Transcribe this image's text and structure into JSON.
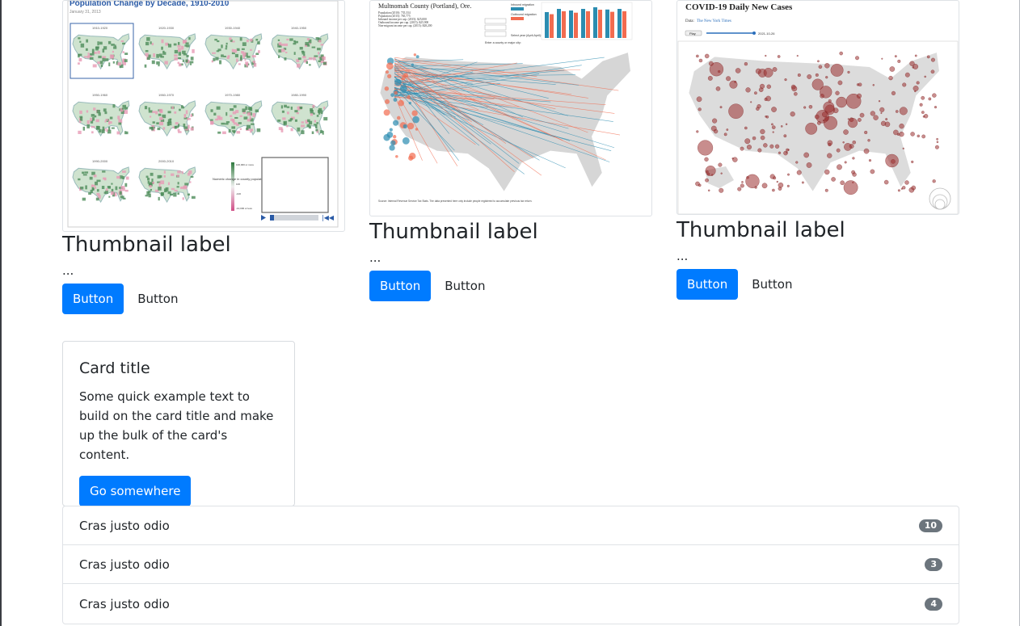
{
  "thumbnails": [
    {
      "image_title": "Population Change by Decade, 1910-2010",
      "image_date": "January 31, 2013",
      "decades": [
        "1910-1920",
        "1920-1930",
        "1930-1940",
        "1940-1950",
        "1950-1960",
        "1960-1970",
        "1970-1980",
        "1980-1990",
        "1990-2000",
        "2000-2010",
        "1910-1920"
      ],
      "legend_title": "Numeric change in county population",
      "legend_ticks": [
        "100,000 or more",
        "100",
        "-100",
        "-10,000 or less"
      ],
      "label": "Thumbnail label",
      "text": "...",
      "primary_button": "Button",
      "secondary_button": "Button"
    },
    {
      "image_title": "Multnomah County (Portland), Ore.",
      "stats": [
        "Population (2010): 735,334",
        "Population (2015): 765,775",
        "Inbound income per cap. (2015): $25,000",
        "Outbound income per cap. (2015): $25,900",
        "Non-migrant income per cap. (2015): $28,200"
      ],
      "legend_inbound": "Inbound migration",
      "legend_outbound": "Outbound migration",
      "select_year": "Select year (April-April):",
      "enter_county": "Enter a county or major city:",
      "footer_note": "Source: Internal Revenue Service Tax Stats. The data presented here only include people registered to accumulate previous tax return.",
      "label": "Thumbnail label",
      "text": "...",
      "primary_button": "Button",
      "secondary_button": "Button"
    },
    {
      "image_title": "COVID-19 Daily New Cases",
      "data_source_prefix": "Data:",
      "data_source": "The New York Times",
      "play_label": "Play",
      "date_readout": "2021-10-26",
      "label": "Thumbnail label",
      "text": "...",
      "primary_button": "Button",
      "secondary_button": "Button"
    }
  ],
  "card": {
    "title": "Card title",
    "text": "Some quick example text to build on the card title and make up the bulk of the card's content.",
    "button": "Go somewhere"
  },
  "list": [
    {
      "text": "Cras justo odio",
      "badge": "10"
    },
    {
      "text": "Cras justo odio",
      "badge": "3"
    },
    {
      "text": "Cras justo odio",
      "badge": "4"
    }
  ],
  "colors": {
    "primary": "#007bff",
    "badge": "#6c757d",
    "map_green": "#4e8c5a",
    "map_pink": "#e79bb5",
    "inbound_blue": "#2b8cb0",
    "outbound_red": "#f26b4f",
    "covid_red": "#9b2f2f"
  }
}
